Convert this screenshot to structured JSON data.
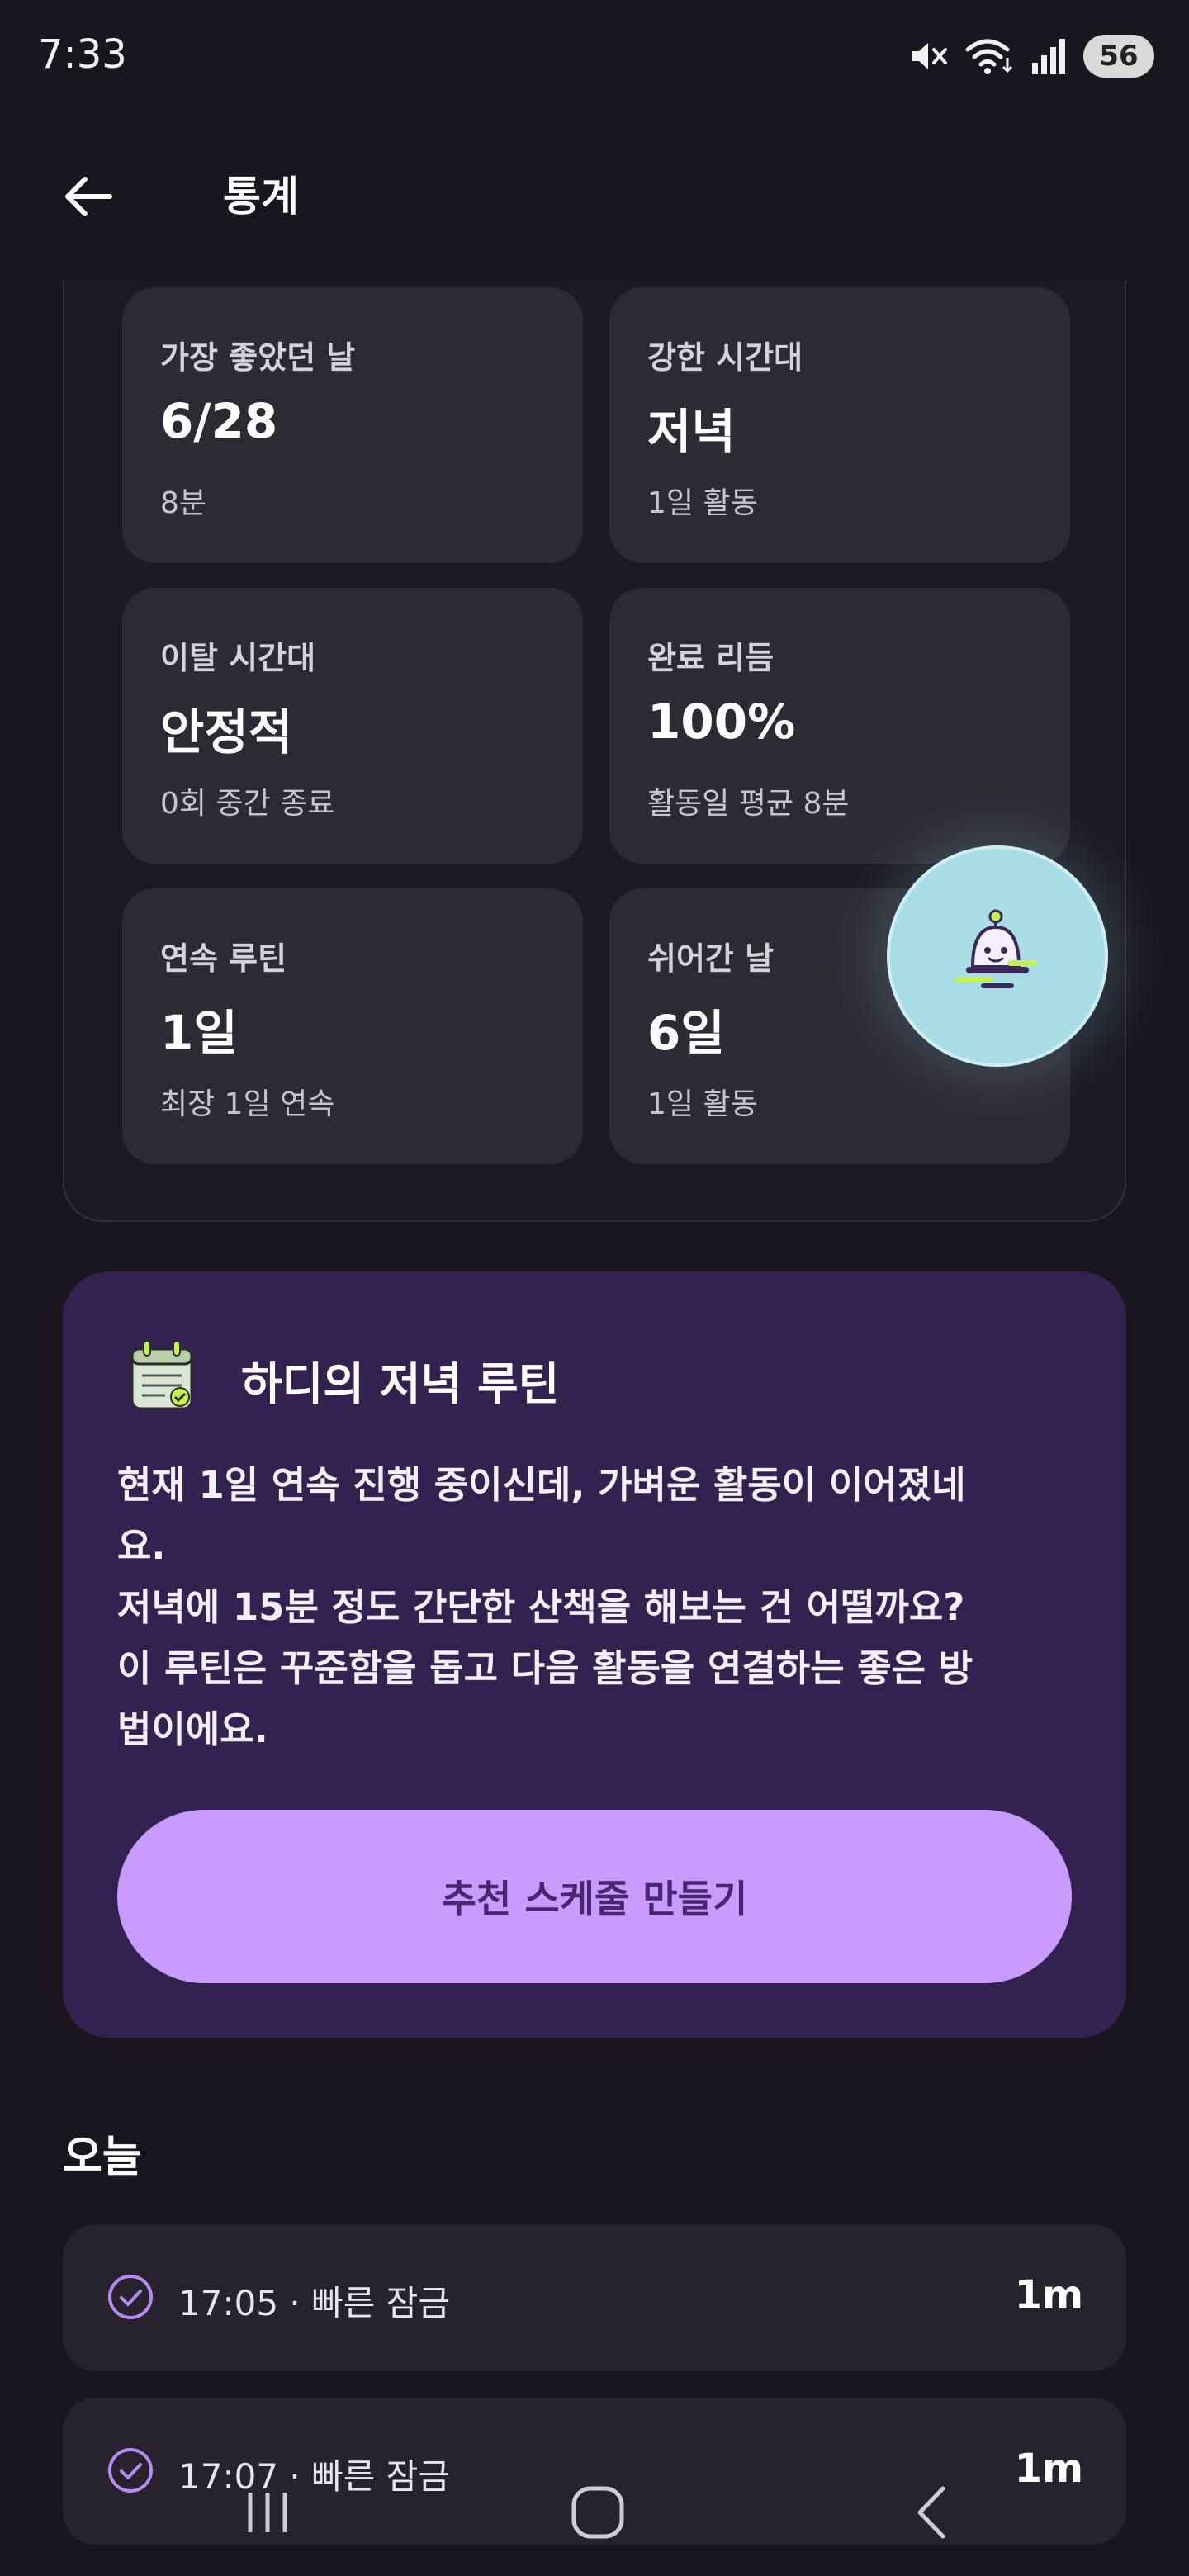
{
  "status": {
    "time": "7:33",
    "battery": "56"
  },
  "header": {
    "title": "통계"
  },
  "stats": [
    {
      "label": "가장 좋았던 날",
      "value": "6/28",
      "sub": "8분"
    },
    {
      "label": "강한 시간대",
      "value": "저녁",
      "sub": "1일 활동"
    },
    {
      "label": "이탈 시간대",
      "value": "안정적",
      "sub": "0회 중간 종료"
    },
    {
      "label": "완료 리듬",
      "value": "100%",
      "sub": "활동일 평균 8분"
    },
    {
      "label": "연속 루틴",
      "value": "1일",
      "sub": "최장 1일 연속"
    },
    {
      "label": "쉬어간 날",
      "value": "6일",
      "sub": "1일 활동"
    }
  ],
  "routine": {
    "title": "하디의 저녁 루틴",
    "body": "현재 1일 연속 진행 중이신데, 가벼운 활동이 이어졌네\n요.\n저녁에 15분 정도 간단한 산책을 해보는 건 어떨까요?\n이 루틴은 꾸준함을 돕고 다음 활동을 연결하는 좋은 방\n법이에요.",
    "cta_label": "추천 스케줄 만들기"
  },
  "today": {
    "title": "오늘",
    "items": [
      {
        "text": "17:05 · 빠른 잠금",
        "duration": "1m"
      },
      {
        "text": "17:07 · 빠른 잠금",
        "duration": "1m"
      }
    ]
  },
  "colors": {
    "background": "#1a1620",
    "card": "#2e2a33",
    "routine_card": "#33224f",
    "cta": "#c99bff",
    "accent_check": "#b58cf0",
    "fab": "#a9dde6"
  },
  "icons": {
    "back": "arrow-left-icon",
    "mute": "mute-icon",
    "wifi": "wifi-icon",
    "signal": "signal-icon",
    "mascot": "mascot-icon",
    "calendar": "calendar-check-icon",
    "check": "check-circle-icon",
    "nav_recents": "recents-icon",
    "nav_home": "home-icon",
    "nav_back": "nav-back-icon"
  }
}
